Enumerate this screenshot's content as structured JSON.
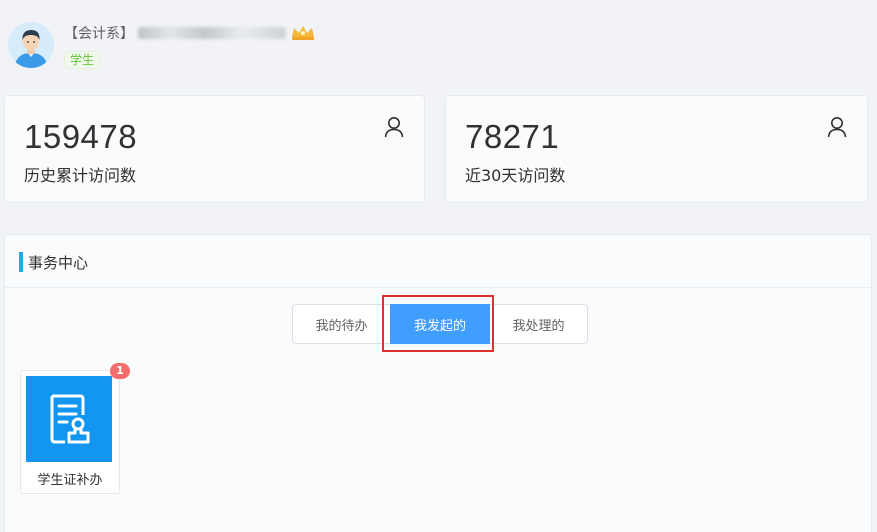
{
  "profile": {
    "department": "【会计系】",
    "role": "学生",
    "vip_icon": "vip-crown-icon"
  },
  "stats": [
    {
      "value": "159478",
      "label": "历史累计访问数",
      "icon": "user-icon"
    },
    {
      "value": "78271",
      "label": "近30天访问数",
      "icon": "user-icon"
    }
  ],
  "panel": {
    "title": "事务中心",
    "tabs": [
      {
        "label": "我的待办"
      },
      {
        "label": "我发起的",
        "active": true
      },
      {
        "label": "我处理的"
      }
    ]
  },
  "services": [
    {
      "label": "学生证补办",
      "badge": "1",
      "icon": "document-stamp-icon"
    }
  ],
  "colors": {
    "accent": "#409eff",
    "tile": "#1296f0",
    "badge": "#f56c6c",
    "highlight": "#e0302e",
    "role_badge": "#67c23a"
  }
}
